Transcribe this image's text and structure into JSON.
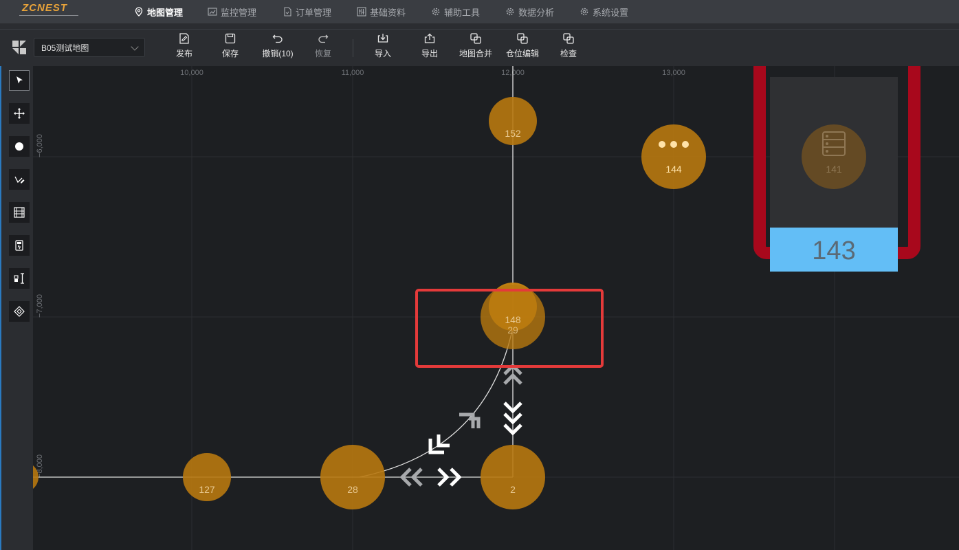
{
  "app": {
    "logo": "ZCNEST"
  },
  "nav": {
    "items": [
      {
        "label": "地图管理",
        "icon": "map-pin-icon",
        "active": true
      },
      {
        "label": "监控管理",
        "icon": "monitor-chart-icon"
      },
      {
        "label": "订单管理",
        "icon": "document-icon"
      },
      {
        "label": "基础资料",
        "icon": "sliders-icon"
      },
      {
        "label": "辅助工具",
        "icon": "gear-icon"
      },
      {
        "label": "数据分析",
        "icon": "gear-icon"
      },
      {
        "label": "系统设置",
        "icon": "gear-icon"
      }
    ]
  },
  "toolbar": {
    "map_select_value": "B05测试地图",
    "buttons": [
      {
        "label": "发布",
        "icon": "publish-icon"
      },
      {
        "label": "保存",
        "icon": "save-icon"
      },
      {
        "label": "撤销(10)",
        "icon": "undo-icon"
      },
      {
        "label": "恢复",
        "icon": "redo-icon",
        "disabled": true
      },
      {
        "label": "导入",
        "icon": "import-icon"
      },
      {
        "label": "导出",
        "icon": "export-icon"
      },
      {
        "label": "地图合并",
        "icon": "merge-icon"
      },
      {
        "label": "仓位编辑",
        "icon": "merge-icon"
      },
      {
        "label": "检查",
        "icon": "merge-icon"
      }
    ]
  },
  "sidebar": {
    "tools": [
      {
        "name": "select",
        "icon": "cursor-arrow-icon",
        "active": true
      },
      {
        "name": "move",
        "icon": "move-arrows-icon"
      },
      {
        "name": "node",
        "icon": "dot-icon"
      },
      {
        "name": "path",
        "icon": "pen-icon"
      },
      {
        "name": "shelf",
        "icon": "shelf-icon"
      },
      {
        "name": "station",
        "icon": "charger-icon"
      },
      {
        "name": "workstation",
        "icon": "workstation-icon"
      },
      {
        "name": "area",
        "icon": "area-icon"
      }
    ]
  },
  "canvas": {
    "x_ticks": [
      "10,000",
      "11,000",
      "12,000",
      "13,000"
    ],
    "y_ticks": [
      "−6,000",
      "−7,000",
      "−8,000"
    ],
    "nodes": [
      {
        "id": "152"
      },
      {
        "id": "144",
        "has_more": true
      },
      {
        "id": "141",
        "has_shelf_icon": true
      },
      {
        "id": "148"
      },
      {
        "id": "29"
      },
      {
        "id": "127"
      },
      {
        "id": "28"
      },
      {
        "id": "2"
      }
    ],
    "shelf_label": "143",
    "colors": {
      "node": "#b8780f",
      "grid": "#2c2e31",
      "path": "#e0e0e0",
      "selection": "#e43a3a",
      "shelf_border": "#a8081c",
      "shelf_label_bg": "#63bef6"
    }
  }
}
